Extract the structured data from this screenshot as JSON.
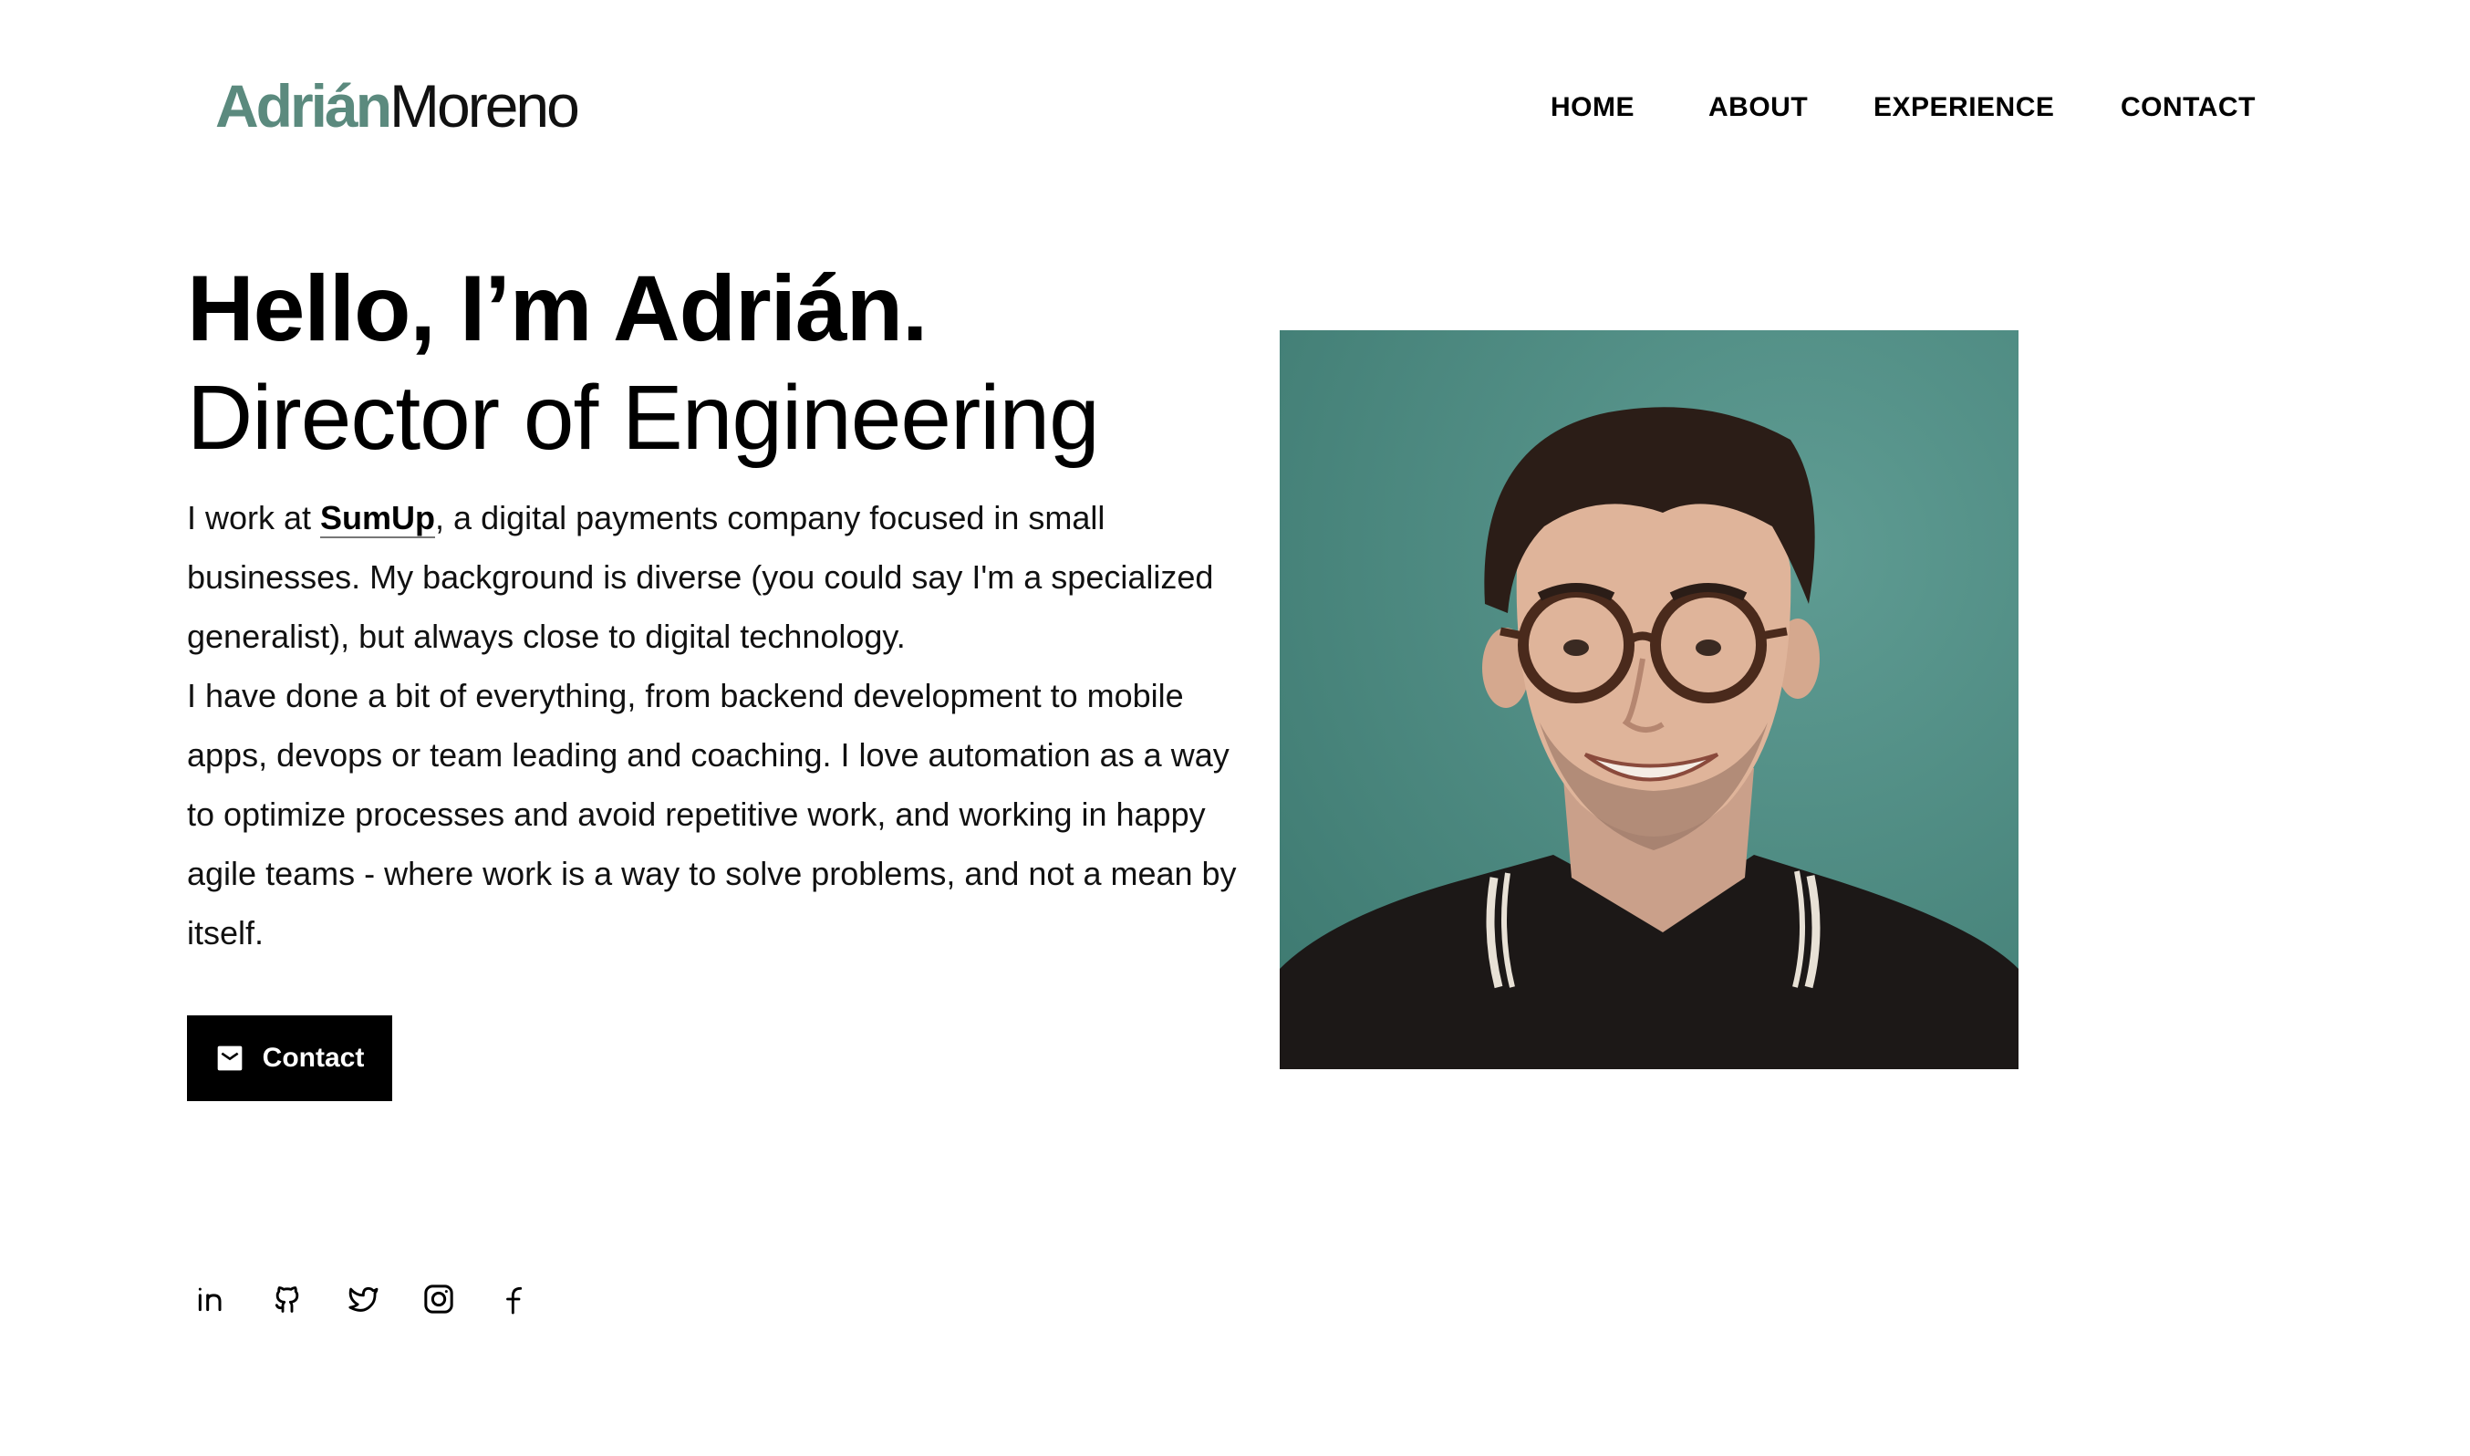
{
  "header": {
    "logo_first": "Adrián",
    "logo_last": "Moreno",
    "nav": [
      "HOME",
      "ABOUT",
      "EXPERIENCE",
      "CONTACT"
    ]
  },
  "hero": {
    "greeting": "Hello, I’m Adrián.",
    "role": "Director of Engineering",
    "bio_intro": "I work at ",
    "company": "SumUp",
    "bio_line1_rest": ", a digital payments company focused in small businesses. My background is diverse (you could say I'm a specialized generalist), but always close to digital technology.",
    "bio_paragraph2": "I have done a bit of everything, from backend development to mobile apps, devops or team leading and coaching. I love automation as a way to optimize processes and avoid repetitive work, and working in happy agile teams - where work is a way to solve problems, and not a mean by itself.",
    "contact_button": "Contact"
  },
  "social": [
    {
      "icon": "linkedin-icon"
    },
    {
      "icon": "github-icon"
    },
    {
      "icon": "twitter-icon"
    },
    {
      "icon": "instagram-icon"
    },
    {
      "icon": "facebook-icon"
    }
  ],
  "colors": {
    "accent": "#5b8a7e",
    "photo_background": "#4f8d84",
    "button": "#000000"
  }
}
